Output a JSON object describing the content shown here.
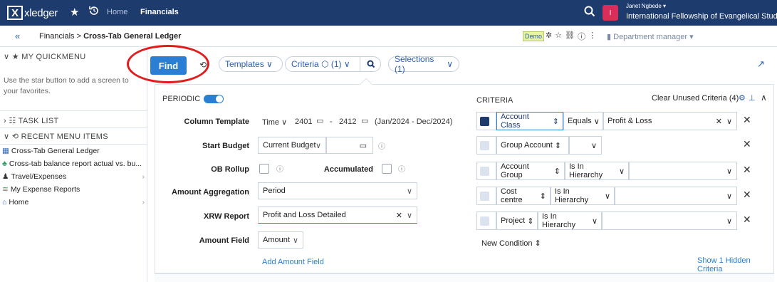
{
  "topbar": {
    "logo_text": "xledger",
    "logo_mark": "X",
    "home": "Home",
    "financials": "Financials",
    "user_name": "Janet Ngbede",
    "user_initial": "I",
    "user_org": "International Fellowship of Evangelical Student"
  },
  "subbar": {
    "collapse": "«",
    "breadcrumb_parent": "Financials",
    "breadcrumb_sep": ">",
    "breadcrumb_current": "Cross-Tab General Ledger",
    "demo_badge": "Demo",
    "department": "Department manager"
  },
  "sidebar": {
    "quickmenu_title": "MY QUICKMENU",
    "quickmenu_hint": "Use the star button to add a screen to your favorites.",
    "task_list_title": "TASK LIST",
    "recent_title": "RECENT MENU ITEMS",
    "items": [
      {
        "label": "Cross-Tab General Ledger",
        "icon": "grid-icon",
        "has_chevron": false
      },
      {
        "label": "Cross-tab balance report actual vs. bu...",
        "icon": "people-icon",
        "has_chevron": false
      },
      {
        "label": "Travel/Expenses",
        "icon": "briefcase-icon",
        "has_chevron": true
      },
      {
        "label": "My Expense Reports",
        "icon": "expense-icon",
        "has_chevron": false
      },
      {
        "label": "Home",
        "icon": "home-icon",
        "has_chevron": true
      }
    ]
  },
  "toolbar": {
    "find_label": "Find",
    "templates_label": "Templates",
    "criteria_label": "Criteria",
    "criteria_count": "(1)",
    "selections_label": "Selections (1)"
  },
  "periodic": {
    "title": "PERIODIC",
    "toggle_on": true,
    "column_template_label": "Column Template",
    "column_template_value": "Time",
    "period_from": "2401",
    "period_sep": "-",
    "period_to": "2412",
    "period_range": "(Jan/2024 - Dec/2024)",
    "start_budget_label": "Start Budget",
    "start_budget_value": "Current Budget",
    "ob_rollup_label": "OB Rollup",
    "accumulated_label": "Accumulated",
    "amount_aggregation_label": "Amount Aggregation",
    "amount_aggregation_value": "Period",
    "xrw_report_label": "XRW Report",
    "xrw_report_value": "Profit and Loss Detailed",
    "amount_field_label": "Amount Field",
    "amount_field_value": "Amount",
    "add_amount_field": "Add Amount Field"
  },
  "criteria": {
    "title": "CRITERIA",
    "clear_unused": "Clear Unused Criteria (4)",
    "rows": [
      {
        "field": "Account Class",
        "operator": "Equals",
        "value": "Profit & Loss",
        "active": true
      },
      {
        "field": "Group Account",
        "operator": "",
        "value": "",
        "active": false
      },
      {
        "field": "Account Group",
        "operator": "Is In Hierarchy",
        "value": "",
        "active": false
      },
      {
        "field": "Cost centre",
        "operator": "Is In Hierarchy",
        "value": "",
        "active": false
      },
      {
        "field": "Project",
        "operator": "Is In Hierarchy",
        "value": "",
        "active": false
      }
    ],
    "new_condition": "New Condition",
    "show_hidden": "Show 1 Hidden Criteria"
  },
  "colors": {
    "topbar_bg": "#1e3b6e",
    "accent": "#2a7fd4",
    "link": "#2a5fb0",
    "avatar": "#d92e5b",
    "highlight_circle": "#e01d1d"
  }
}
